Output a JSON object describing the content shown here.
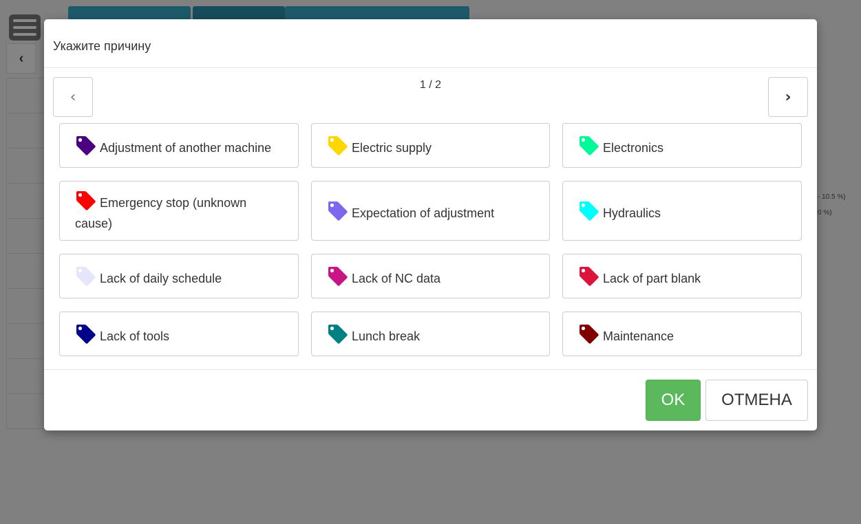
{
  "background": {
    "back_glyph": "‹",
    "legend": [
      "- 10.5 %)",
      "0 %)"
    ]
  },
  "dialog": {
    "title": "Укажите причину",
    "page_indicator": "1 / 2",
    "prev_glyph": "‹",
    "next_glyph": "›",
    "reasons": [
      {
        "label": "Adjustment of another machine",
        "color": "#4b0082",
        "icon": "tag-icon"
      },
      {
        "label": "Electric supply",
        "color": "#ffd700",
        "icon": "tag-icon"
      },
      {
        "label": "Electronics",
        "color": "#00fa9a",
        "icon": "tag-icon"
      },
      {
        "label": "Emergency stop (unknown cause)",
        "color": "#ff0000",
        "icon": "tag-icon"
      },
      {
        "label": "Expectation of adjustment",
        "color": "#7b68ee",
        "icon": "tag-icon"
      },
      {
        "label": "Hydraulics",
        "color": "#00ffff",
        "icon": "tag-icon"
      },
      {
        "label": "Lack of daily schedule",
        "color": "#e6e6fa",
        "icon": "tag-icon"
      },
      {
        "label": "Lack of NC data",
        "color": "#c71585",
        "icon": "tag-icon"
      },
      {
        "label": "Lack of part blank",
        "color": "#dc143c",
        "icon": "tag-icon"
      },
      {
        "label": "Lack of tools",
        "color": "#00008b",
        "icon": "tag-icon"
      },
      {
        "label": "Lunch break",
        "color": "#008080",
        "icon": "tag-icon"
      },
      {
        "label": "Maintenance",
        "color": "#800000",
        "icon": "tag-icon"
      }
    ],
    "ok_label": "OK",
    "cancel_label": "ОТМЕНА"
  }
}
